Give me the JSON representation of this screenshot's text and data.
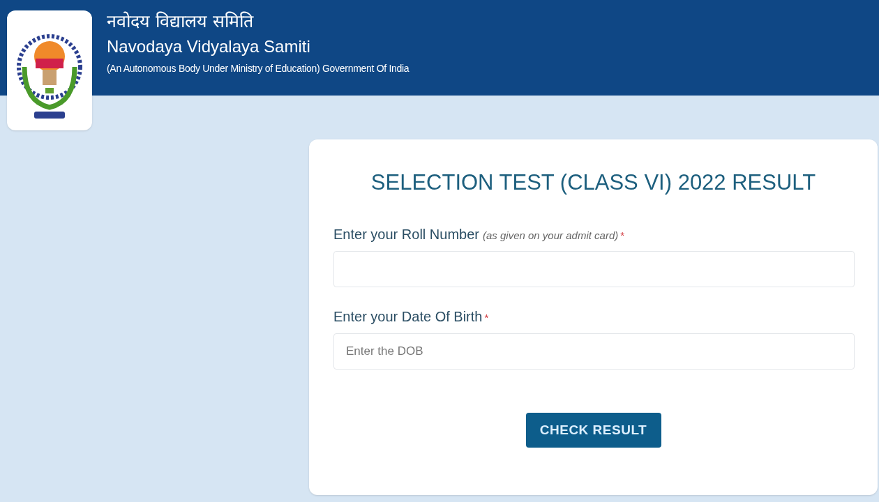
{
  "header": {
    "title_hindi": "नवोदय विद्यालय समिति",
    "title": "Navodaya Vidyalaya Samiti",
    "subtitle": "(An Autonomous Body Under Ministry of Education) Government Of India"
  },
  "form": {
    "title": "SELECTION TEST (CLASS VI) 2022 RESULT",
    "fields": [
      {
        "label": "Enter your Roll Number",
        "hint": "(as given on your admit card)",
        "mark": "*"
      },
      {
        "label": "Enter your Date Of Birth",
        "mark": "*",
        "placeholder": "Enter the DOB"
      }
    ],
    "button": "CHECK RESULT"
  }
}
